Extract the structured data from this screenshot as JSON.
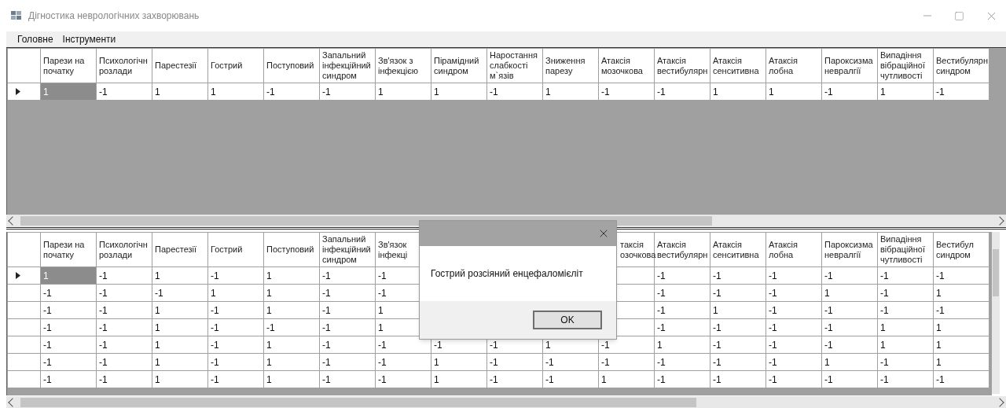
{
  "window": {
    "title": "Дігностика неврологічних захворювань"
  },
  "menu": [
    "Головне",
    "Інструменти"
  ],
  "top_grid": {
    "columns": [
      "Парези на\nпочатку",
      "Психологічн\nрозлади",
      "Парестезії",
      "Гострий",
      "Поступовий",
      "Запальний\nінфекційний\nсиндром",
      "Зв'язок з\nінфекцією",
      "Пірамідний\nсиндром",
      "Наростання\nслабкості\nм`язів",
      "Зниження\nпарезу",
      "Атаксія\nмозочкова",
      "Атаксія\nвестибулярн",
      "Атаксія\nсенситивна",
      "Атаксія\nлобна",
      "Пароксизма\nневралгії",
      "Випадіння\nвібраційної\nчутливості",
      "Вестибулярн\nсиндром"
    ],
    "rows": [
      {
        "current": true,
        "cells": [
          "1",
          "-1",
          "1",
          "1",
          "-1",
          "-1",
          "1",
          "1",
          "-1",
          "1",
          "-1",
          "-1",
          "1",
          "1",
          "-1",
          "1",
          "-1"
        ]
      }
    ]
  },
  "bottom_grid": {
    "columns": [
      "Парези на\nпочатку",
      "Психологічн\nрозлади",
      "Парестезії",
      "Гострий",
      "Поступовий",
      "Запальний\nінфекційний\nсиндром",
      "Зв'язок\nінфекці",
      null,
      null,
      null,
      "таксія\nозочкова",
      "Атаксія\nвестибулярн",
      "Атаксія\nсенситивна",
      "Атаксія\nлобна",
      "Пароксизма\nневралгії",
      "Випадіння\nвібраційної\nчутливості",
      "Вестибул\nсиндром"
    ],
    "rows": [
      {
        "current": true,
        "cells": [
          "1",
          "-1",
          "1",
          "-1",
          "1",
          "-1",
          "-1",
          null,
          null,
          null,
          null,
          "-1",
          "-1",
          "-1",
          "-1",
          "-1",
          "-1"
        ]
      },
      {
        "current": false,
        "cells": [
          "-1",
          "-1",
          "-1",
          "1",
          "1",
          "-1",
          "-1",
          null,
          null,
          null,
          null,
          "-1",
          "-1",
          "-1",
          "1",
          "-1",
          "1"
        ]
      },
      {
        "current": false,
        "cells": [
          "-1",
          "-1",
          "1",
          "-1",
          "1",
          "-1",
          "1",
          null,
          null,
          null,
          null,
          "-1",
          "1",
          "-1",
          "-1",
          "-1",
          "-1"
        ]
      },
      {
        "current": false,
        "cells": [
          "-1",
          "-1",
          "1",
          "-1",
          "-1",
          "-1",
          "1",
          null,
          null,
          null,
          null,
          "-1",
          "-1",
          "-1",
          "-1",
          "1",
          "1"
        ]
      },
      {
        "current": false,
        "cells": [
          "-1",
          "-1",
          "1",
          "-1",
          "1",
          "-1",
          "-1",
          "-1",
          "-1",
          "1",
          "-1",
          "1",
          "-1",
          "-1",
          "-1",
          "1",
          "1"
        ]
      },
      {
        "current": false,
        "cells": [
          "-1",
          "-1",
          "1",
          "-1",
          "1",
          "-1",
          "-1",
          "1",
          "-1",
          "-1",
          "-1",
          "-1",
          "-1",
          "-1",
          "1",
          "-1",
          "1"
        ]
      },
      {
        "current": false,
        "cells": [
          "-1",
          "-1",
          "1",
          "-1",
          "1",
          "-1",
          "-1",
          "1",
          "-1",
          "-1",
          "1",
          "-1",
          "-1",
          "-1",
          "-1",
          "-1",
          "-1"
        ]
      }
    ]
  },
  "dialog": {
    "message": "Гострий розсіяний енцефаломієліт",
    "button": "OK"
  }
}
